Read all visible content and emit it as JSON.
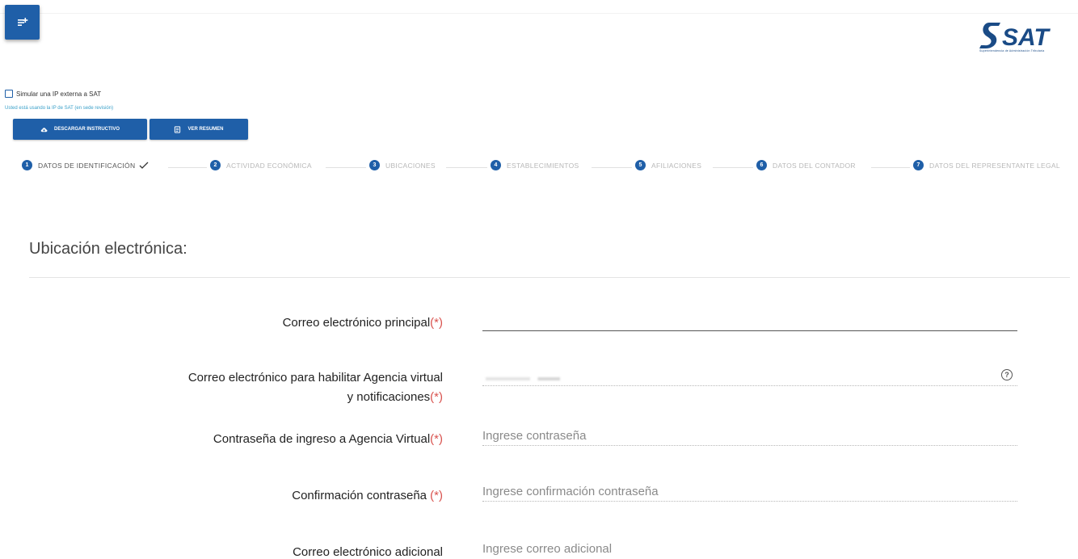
{
  "header": {
    "menu_icon": "edit-note-icon",
    "logo_text": "SAT",
    "logo_subtitle": "Superintendencia de Administración Tributaria"
  },
  "simulation": {
    "checkbox_label": "Simular una IP externa a SAT",
    "ip_note": "Usted está usando la IP de SAT (en sede revisión)",
    "checked": false
  },
  "actions": {
    "download_label": "Descargar instructivo",
    "download_icon": "cloud-download-icon",
    "summary_label": "Ver resumen",
    "summary_icon": "document-icon"
  },
  "steps": [
    {
      "num": "1",
      "label": "Datos de identificación",
      "done": true
    },
    {
      "num": "2",
      "label": "Actividad económica"
    },
    {
      "num": "3",
      "label": "Ubicaciones"
    },
    {
      "num": "4",
      "label": "Establecimientos"
    },
    {
      "num": "5",
      "label": "Afiliaciones"
    },
    {
      "num": "6",
      "label": "Datos del contador"
    },
    {
      "num": "7",
      "label": "Datos del representante legal"
    }
  ],
  "section": {
    "title": "Ubicación electrónica:"
  },
  "form": {
    "email_main": {
      "label": "Correo electrónico principal",
      "required": "(*)",
      "value": ""
    },
    "email_agency": {
      "label_line1": "Correo electrónico para habilitar Agencia virtual",
      "label_line2": "y notificaciones",
      "required": "(*)",
      "help_icon": "help-circle-icon"
    },
    "password": {
      "label": "Contraseña de ingreso a Agencia Virtual",
      "required": "(*)",
      "placeholder": "Ingrese contraseña"
    },
    "password_confirm": {
      "label": "Confirmación contraseña ",
      "required": "(*)",
      "placeholder": "Ingrese confirmación contraseña"
    },
    "email_extra": {
      "label": "Correo electrónico adicional",
      "placeholder": "Ingrese correo adicional"
    }
  },
  "colors": {
    "primary": "#1f5fa8",
    "required": "#d9534f",
    "step_inactive": "#b8b8b8"
  }
}
